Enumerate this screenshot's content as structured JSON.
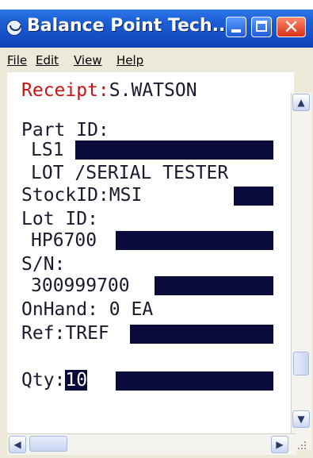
{
  "window": {
    "title": "Balance Point Tech...",
    "icon": "app-logo-icon",
    "controls": {
      "minimize": "minimize-icon",
      "maximize": "maximize-icon",
      "close": "✕"
    }
  },
  "menu": {
    "file": "File",
    "edit": "Edit",
    "view": "View",
    "help": "Help"
  },
  "screen": {
    "receipt_label": "Receipt:",
    "receipt_value": "S.WATSON",
    "part_id_label": "Part ID:",
    "part_id_value": "LS1",
    "part_desc": "LOT /SERIAL TESTER",
    "stockid_label": "StockID:",
    "stockid_value": "MSI",
    "lot_id_label": "Lot ID:",
    "lot_id_value": "HP6700",
    "sn_label": "S/N:",
    "sn_value": "300999700",
    "onhand_label": "OnHand:",
    "onhand_value": "0 EA",
    "ref_label": "Ref:",
    "ref_value": "TREF",
    "qty_label": "Qty:",
    "qty_value": "10"
  },
  "colors": {
    "mask": "#0b0b3b",
    "receipt_label": "#cc1111",
    "titlebar": "#1d5fd6"
  }
}
